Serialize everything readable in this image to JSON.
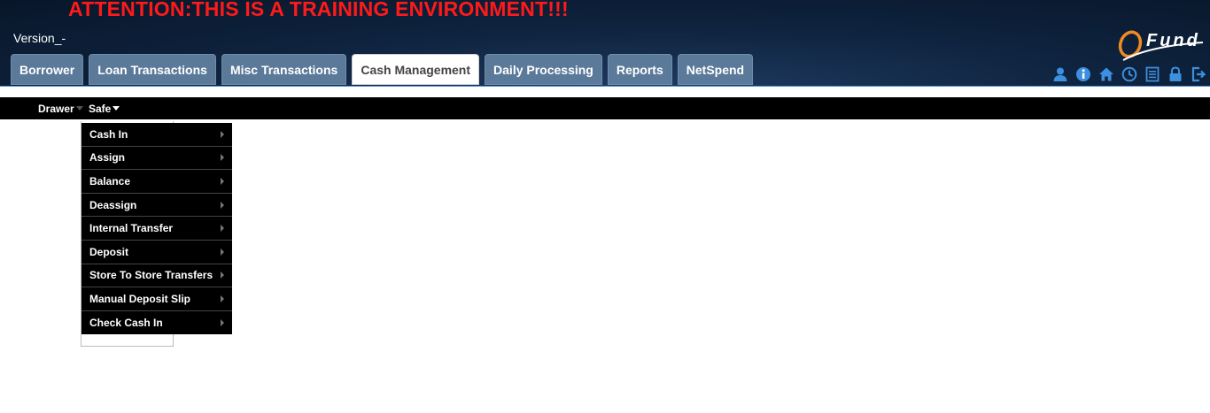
{
  "banner": "ATTENTION:THIS IS A TRAINING ENVIRONMENT!!!",
  "version": "Version_-",
  "logo": {
    "letter": "Q",
    "text": "Fund"
  },
  "tabs": [
    {
      "label": "Borrower"
    },
    {
      "label": "Loan Transactions"
    },
    {
      "label": "Misc Transactions"
    },
    {
      "label": "Cash Management",
      "active": true
    },
    {
      "label": "Daily Processing"
    },
    {
      "label": "Reports"
    },
    {
      "label": "NetSpend"
    }
  ],
  "toolbar_icons": [
    "user-icon",
    "info-icon",
    "home-icon",
    "clock-icon",
    "list-icon",
    "lock-icon",
    "logout-icon"
  ],
  "subnav": {
    "drawer": "Drawer",
    "safe": "Safe"
  },
  "safe_menu": [
    "Cash In",
    "Assign",
    "Balance",
    "Deassign",
    "Internal Transfer",
    "Deposit",
    "Store To Store Transfers",
    "Manual Deposit Slip",
    "Check Cash In"
  ],
  "colors": {
    "banner": "#ff1a1a",
    "tab": "#5b7a99",
    "icon": "#3d8fe0",
    "menu_bg": "#000000"
  }
}
